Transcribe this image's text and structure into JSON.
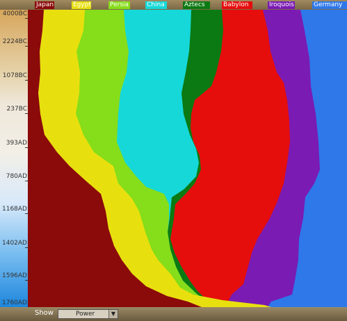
{
  "legend": [
    {
      "label": "Japan",
      "color": "#8b0a0a"
    },
    {
      "label": "Egypt",
      "color": "#e8e00e"
    },
    {
      "label": "Persia",
      "color": "#86dd1a"
    },
    {
      "label": "China",
      "color": "#16d8d8"
    },
    {
      "label": "Aztecs",
      "color": "#0b7a12"
    },
    {
      "label": "Babylon",
      "color": "#e60d0d"
    },
    {
      "label": "Iroquois",
      "color": "#7a1bb3"
    },
    {
      "label": "Germany",
      "color": "#2e78ea"
    }
  ],
  "y_axis_labels": [
    "4000BC",
    "2224BC",
    "1078BC",
    "237BC",
    "393AD",
    "780AD",
    "1168AD",
    "1402AD",
    "1596AD",
    "1760AD"
  ],
  "controls": {
    "show_label": "Show",
    "dropdown_value": "Power",
    "dropdown_arrow": "▼"
  }
}
